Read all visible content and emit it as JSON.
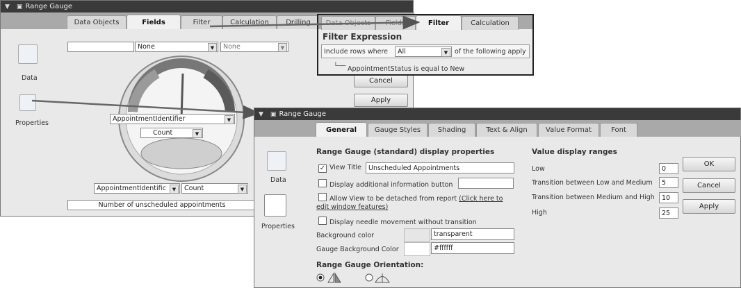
{
  "window1": {
    "title": "Range Gauge",
    "tabs": [
      "Data Objects",
      "Fields",
      "Filter",
      "Calculation",
      "Drilling"
    ],
    "active_tab": "Fields",
    "side": {
      "data_label": "Data",
      "properties_label": "Properties"
    },
    "top_field_1": "None",
    "top_field_2": "None",
    "gauge_field": "AppointmentIdentifier",
    "gauge_agg": "Count",
    "bottom_field": "AppointmentIdentific",
    "bottom_agg": "Count",
    "caption": "Number of unscheduled appointments",
    "cancel_label": "Cancel",
    "apply_label": "Apply"
  },
  "filter_popup": {
    "tabs": [
      "Data Objects",
      "Fields",
      "Filter",
      "Calculation"
    ],
    "active_tab": "Filter",
    "heading": "Filter Expression",
    "include_prefix": "Include rows where",
    "include_value": "All",
    "include_suffix": "of the following apply",
    "condition": "AppointmentStatus  is equal to  New"
  },
  "window2": {
    "title": "Range Gauge",
    "tabs": [
      "General",
      "Gauge Styles",
      "Shading",
      "Text & Align",
      "Value Format",
      "Font"
    ],
    "active_tab": "General",
    "side": {
      "data_label": "Data",
      "properties_label": "Properties"
    },
    "section_title": "Range Gauge (standard) display properties",
    "view_title_label": "View Title",
    "view_title_value": "Unscheduled Appointments",
    "view_title_checked": true,
    "additional_info_label": "Display additional information button",
    "detach_label": "Allow View to be detached from report",
    "detach_link": "(Click here to",
    "detach_label_2": "edit window features)",
    "needle_label": "Display needle movement without transition",
    "bg_color_label": "Background color",
    "bg_color_value": "transparent",
    "gauge_bg_label": "Gauge Background Color",
    "gauge_bg_value": "#ffffff",
    "orientation_title": "Range Gauge Orientation:",
    "ranges_title": "Value display ranges",
    "ranges": [
      {
        "label": "Low",
        "value": "0"
      },
      {
        "label": "Transition between Low and Medium",
        "value": "5"
      },
      {
        "label": "Transition between Medium and High",
        "value": "10"
      },
      {
        "label": "High",
        "value": "25"
      }
    ],
    "ok_label": "OK",
    "cancel_label": "Cancel",
    "apply_label": "Apply"
  },
  "colors": {
    "titlebar": "#3a3a3a",
    "tab_active": "#f1f1f1",
    "panel": "#e9e9e9"
  }
}
